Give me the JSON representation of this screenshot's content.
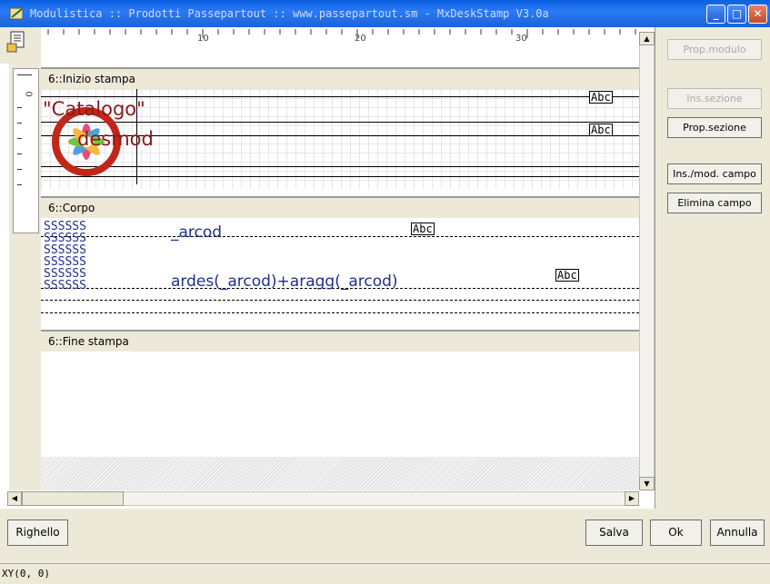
{
  "window": {
    "title": "Modulistica :: Prodotti Passepartout :: www.passepartout.sm - MxDeskStamp V3.0a"
  },
  "ruler": {
    "marks": [
      "10",
      "20",
      "30"
    ],
    "left_mark": "0"
  },
  "sections": {
    "inizio": {
      "header": "6::Inizio stampa",
      "logo_text_1": "\"Catalogo\"",
      "logo_text_2": "desmod",
      "abc1": "Abc",
      "abc2": "Abc"
    },
    "corpo": {
      "header": "6::Corpo",
      "field1": "_arcod",
      "field2": "ardes(_arcod)+aragg(_arcod)",
      "abc1": "Abc",
      "abc2": "Abc",
      "s_row": "SSSSSS"
    },
    "fine": {
      "header": "6::Fine stampa"
    }
  },
  "right_panel": {
    "prop_modulo": "Prop.modulo",
    "ins_sezione": "Ins.sezione",
    "prop_sezione": "Prop.sezione",
    "ins_mod_campo": "Ins./mod. campo",
    "elimina_campo": "Elimina campo"
  },
  "bottom_buttons": {
    "righello": "Righello",
    "salva": "Salva",
    "ok": "Ok",
    "annulla": "Annulla"
  },
  "status": {
    "coords": "XY(0, 0)"
  },
  "colors": {
    "titlebar": "#1c63d8",
    "field_text": "#1e2f8e",
    "logo_red": "#c0271a"
  }
}
